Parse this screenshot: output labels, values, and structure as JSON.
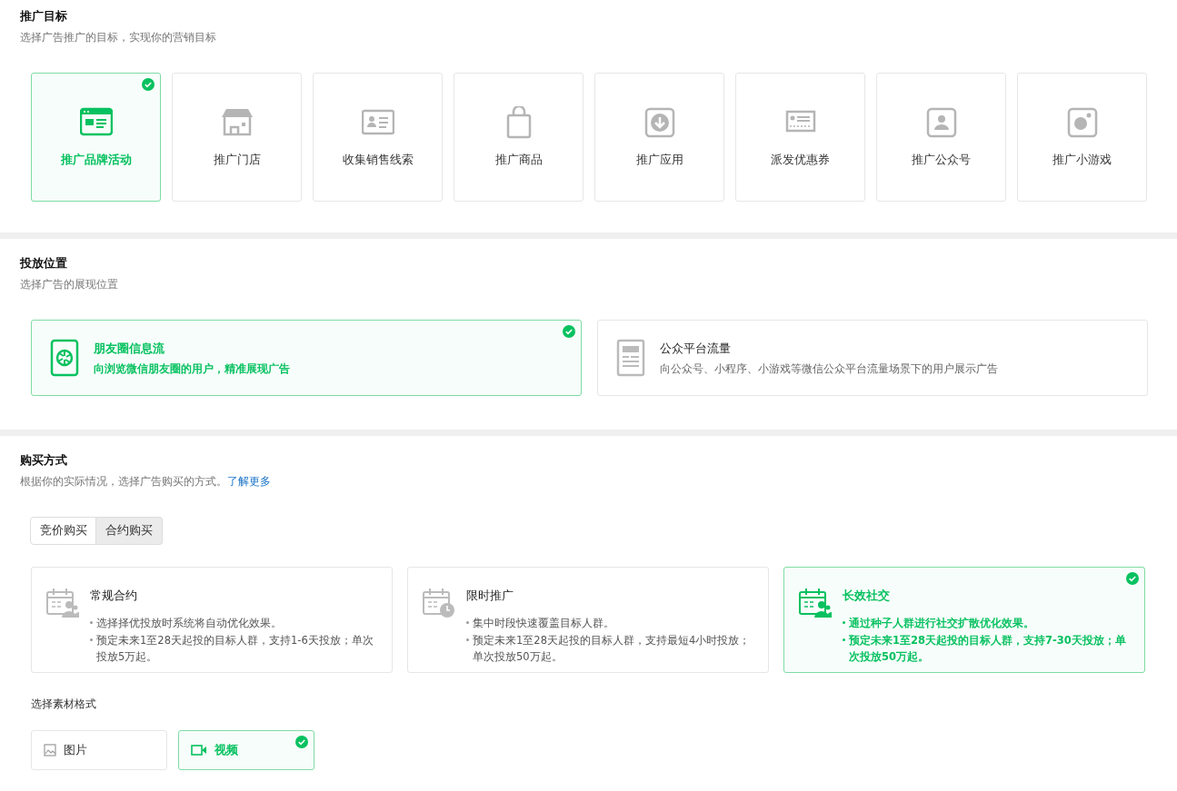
{
  "objective": {
    "title": "推广目标",
    "subtitle": "选择广告推广的目标，实现你的营销目标",
    "options": [
      {
        "label": "推广品牌活动",
        "selected": true
      },
      {
        "label": "推广门店",
        "selected": false
      },
      {
        "label": "收集销售线索",
        "selected": false
      },
      {
        "label": "推广商品",
        "selected": false
      },
      {
        "label": "推广应用",
        "selected": false
      },
      {
        "label": "派发优惠券",
        "selected": false
      },
      {
        "label": "推广公众号",
        "selected": false
      },
      {
        "label": "推广小游戏",
        "selected": false
      }
    ]
  },
  "placement": {
    "title": "投放位置",
    "subtitle": "选择广告的展现位置",
    "options": [
      {
        "title": "朋友圈信息流",
        "description": "向浏览微信朋友圈的用户，精准展现广告",
        "selected": true
      },
      {
        "title": "公众平台流量",
        "description": "向公众号、小程序、小游戏等微信公众平台流量场景下的用户展示广告",
        "selected": false
      }
    ]
  },
  "purchase": {
    "title": "购买方式",
    "subtitle": "根据你的实际情况，选择广告购买的方式。",
    "link": "了解更多",
    "tabs": [
      {
        "label": "竞价购买",
        "selected": false
      },
      {
        "label": "合约购买",
        "selected": true
      }
    ],
    "plans": [
      {
        "title": "常规合约",
        "bullets": [
          "选择择优投放时系统将自动优化效果。",
          "预定未来1至28天起投的目标人群，支持1-6天投放；单次投放5万起。"
        ],
        "selected": false
      },
      {
        "title": "限时推广",
        "bullets": [
          "集中时段快速覆盖目标人群。",
          "预定未来1至28天起投的目标人群，支持最短4小时投放；单次投放50万起。"
        ],
        "selected": false
      },
      {
        "title": "长效社交",
        "bullets": [
          "通过种子人群进行社交扩散优化效果。",
          "预定未来1至28天起投的目标人群，支持7-30天投放；单次投放50万起。"
        ],
        "selected": true
      }
    ],
    "format_label": "选择素材格式",
    "formats": [
      {
        "label": "图片",
        "selected": false
      },
      {
        "label": "视频",
        "selected": true
      }
    ]
  }
}
